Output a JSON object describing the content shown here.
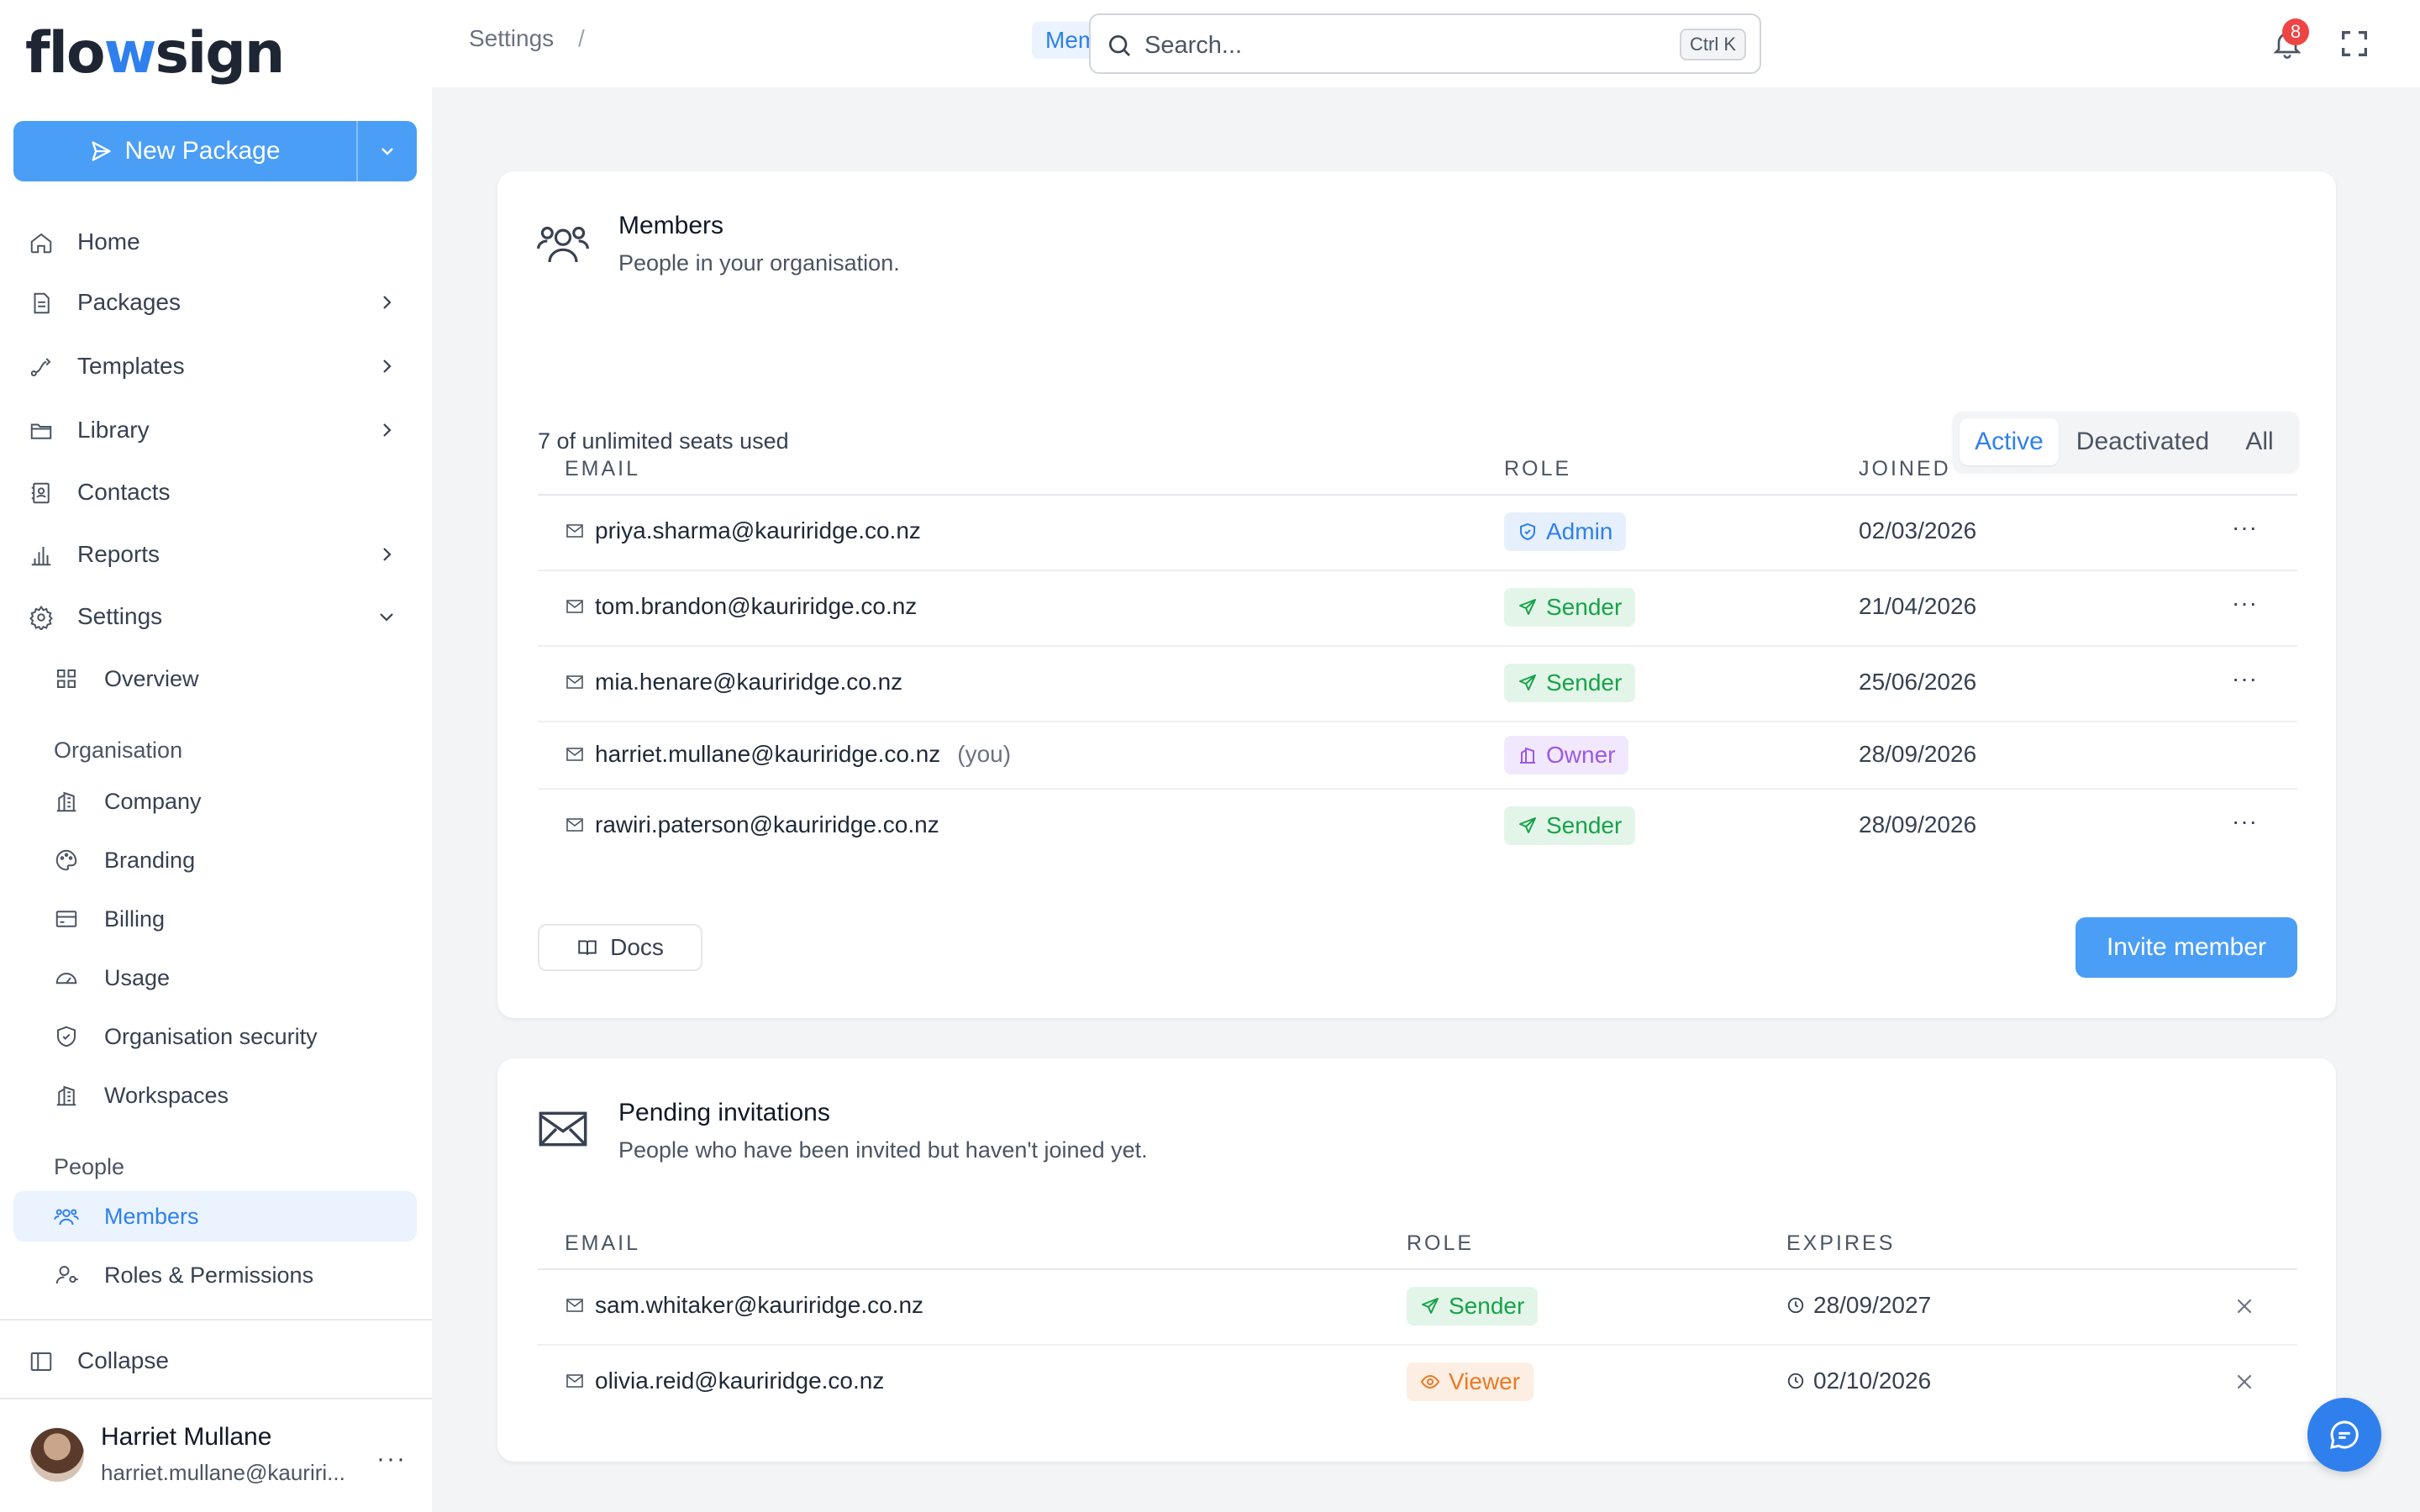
{
  "brand": {
    "logo_text": "flowsign",
    "accent": "#2f80ed"
  },
  "sidebar": {
    "new_package_label": "New Package",
    "nav": [
      {
        "label": "Home",
        "icon": "home-icon"
      },
      {
        "label": "Packages",
        "icon": "document-icon"
      },
      {
        "label": "Templates",
        "icon": "workflow-icon"
      },
      {
        "label": "Library",
        "icon": "folder-icon"
      },
      {
        "label": "Contacts",
        "icon": "contact-book-icon"
      },
      {
        "label": "Reports",
        "icon": "bar-chart-icon"
      },
      {
        "label": "Settings",
        "icon": "gear-icon"
      }
    ],
    "overview_label": "Overview",
    "organisation_heading": "Organisation",
    "organisation_items": [
      {
        "label": "Company",
        "icon": "building-icon"
      },
      {
        "label": "Branding",
        "icon": "palette-icon"
      },
      {
        "label": "Billing",
        "icon": "credit-card-icon"
      },
      {
        "label": "Usage",
        "icon": "gauge-icon"
      },
      {
        "label": "Organisation security",
        "icon": "shield-icon"
      },
      {
        "label": "Workspaces",
        "icon": "building-icon"
      }
    ],
    "people_heading": "People",
    "people_items": [
      {
        "label": "Members",
        "icon": "users-icon",
        "active": true
      },
      {
        "label": "Roles & Permissions",
        "icon": "user-key-icon"
      }
    ],
    "collapse_label": "Collapse",
    "user": {
      "name": "Harriet Mullane",
      "email": "harriet.mullane@kauriri..."
    }
  },
  "topbar": {
    "breadcrumb": [
      "Settings",
      "Members"
    ],
    "search_placeholder": "Search...",
    "search_shortcut": "Ctrl K",
    "notification_count": "8"
  },
  "members_card": {
    "title": "Members",
    "subtitle": "People in your organisation.",
    "seats_text": "7 of unlimited seats used",
    "filters": [
      "Active",
      "Deactivated",
      "All"
    ],
    "active_filter": "Active",
    "columns": [
      "EMAIL",
      "ROLE",
      "JOINED"
    ],
    "rows": [
      {
        "email": "priya.sharma@kauriridge.co.nz",
        "you": "",
        "role": "Admin",
        "joined": "02/03/2026",
        "more": "···"
      },
      {
        "email": "tom.brandon@kauriridge.co.nz",
        "you": "",
        "role": "Sender",
        "joined": "21/04/2026",
        "more": "···"
      },
      {
        "email": "mia.henare@kauriridge.co.nz",
        "you": "",
        "role": "Sender",
        "joined": "25/06/2026",
        "more": "···"
      },
      {
        "email": "harriet.mullane@kauriridge.co.nz",
        "you": "(you)",
        "role": "Owner",
        "joined": "28/09/2026",
        "more": ""
      },
      {
        "email": "rawiri.paterson@kauriridge.co.nz",
        "you": "",
        "role": "Sender",
        "joined": "28/09/2026",
        "more": "···"
      }
    ],
    "docs_label": "Docs",
    "invite_label": "Invite member"
  },
  "pending_card": {
    "title": "Pending invitations",
    "subtitle": "People who have been invited but haven't joined yet.",
    "columns": [
      "EMAIL",
      "ROLE",
      "EXPIRES"
    ],
    "rows": [
      {
        "email": "sam.whitaker@kauriridge.co.nz",
        "role": "Sender",
        "expires": "28/09/2027"
      },
      {
        "email": "olivia.reid@kauriridge.co.nz",
        "role": "Viewer",
        "expires": "02/10/2026"
      }
    ]
  },
  "colors": {
    "admin": "#2f80ed",
    "sender": "#16a34a",
    "owner": "#9b59e6",
    "viewer": "#ea7a25",
    "primary_button": "#4a9ef5"
  }
}
